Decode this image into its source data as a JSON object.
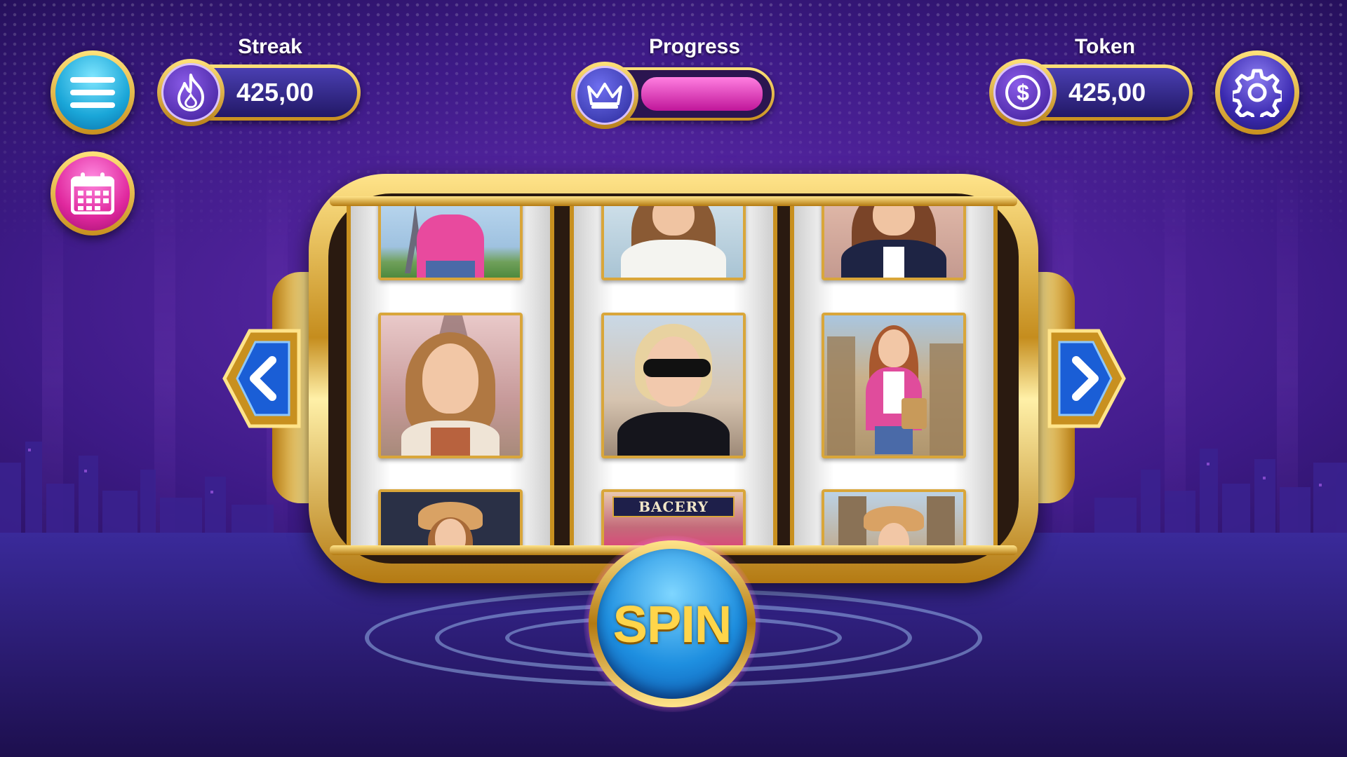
{
  "hud": {
    "streak": {
      "label": "Streak",
      "value": "425,00"
    },
    "progress": {
      "label": "Progress",
      "fill_fraction": 0.97
    },
    "token": {
      "label": "Token",
      "value": "425,00"
    }
  },
  "buttons": {
    "menu_icon": "hamburger-menu-icon",
    "calendar_icon": "calendar-icon",
    "settings_icon": "gear-icon",
    "prev_icon": "chevron-left-icon",
    "next_icon": "chevron-right-icon",
    "spin_label": "SPIN"
  },
  "reels": [
    {
      "tiles": [
        "eiffel-tower-pink-shirt",
        "woman-eiffel-tower",
        "woman-sun-hat"
      ]
    },
    {
      "tiles": [
        "woman-white-blazer",
        "woman-sunglasses-street",
        "bakery-storefront"
      ]
    },
    {
      "tiles": [
        "woman-navy-blazer",
        "woman-pink-jacket-notre-dame",
        "woman-sun-hat-notre-dame"
      ]
    }
  ],
  "reel_signs": {
    "bakery": "BACERY"
  },
  "colors": {
    "gold": "#d9a63a",
    "progress_fill": "#e23cc0",
    "spin_blue": "#1e8fe0",
    "spin_text": "#ffd54a"
  }
}
